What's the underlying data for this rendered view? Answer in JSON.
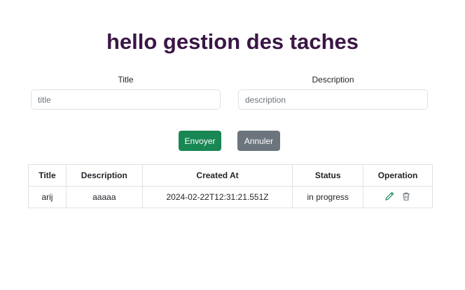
{
  "page_title": "hello gestion des taches",
  "form": {
    "title_label": "Title",
    "title_placeholder": "title",
    "title_value": "",
    "description_label": "Description",
    "description_placeholder": "description",
    "description_value": "",
    "submit_label": "Envoyer",
    "cancel_label": "Annuler"
  },
  "table": {
    "headers": [
      "Title",
      "Description",
      "Created At",
      "Status",
      "Operation"
    ],
    "rows": [
      {
        "title": "arij",
        "description": "aaaaa",
        "created_at": "2024-02-22T12:31:21.551Z",
        "status": "in progress",
        "operations": [
          "pencil-icon",
          "trash-icon"
        ]
      }
    ]
  },
  "colors": {
    "title": "#3b1645",
    "submit": "#198754",
    "cancel": "#6c757d",
    "edit_icon": "#198754",
    "delete_icon": "#6c757d"
  }
}
